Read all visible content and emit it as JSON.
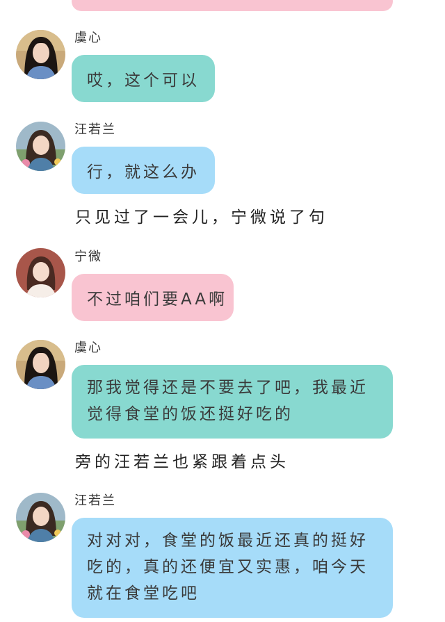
{
  "colors": {
    "bubble_green": "#88d9d0",
    "bubble_blue": "#a6dcf9",
    "bubble_pink": "#f9c4d1"
  },
  "messages": [
    {
      "sender": "虞心",
      "text": "哎，这个可以",
      "bubble": "green"
    },
    {
      "sender": "汪若兰",
      "text": "行，就这么办",
      "bubble": "blue"
    },
    {
      "sender": "宁微",
      "text": "不过咱们要AA啊",
      "bubble": "pink"
    },
    {
      "sender": "虞心",
      "lines": [
        "那我觉得还是不要去了吧，我最近",
        "觉得食堂的饭还挺好吃的"
      ],
      "bubble": "green"
    },
    {
      "sender": "汪若兰",
      "lines": [
        "对对对，食堂的饭最近还真的挺好",
        "吃的，真的还便宜又实惠，咱今天",
        "就在食堂吃吧"
      ],
      "bubble": "blue"
    }
  ],
  "narration": [
    "只见过了一会儿，宁微说了句",
    "旁的汪若兰也紧跟着点头"
  ]
}
